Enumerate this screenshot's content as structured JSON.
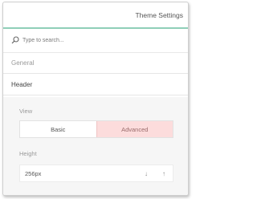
{
  "window": {
    "title": "Theme Settings"
  },
  "search": {
    "placeholder": "Type to search..."
  },
  "sections": {
    "general_label": "General",
    "header_label": "Header"
  },
  "view": {
    "label": "View",
    "options": [
      "Basic",
      "Advanced"
    ],
    "selected": "Advanced"
  },
  "height": {
    "label": "Height",
    "value": "256px",
    "down_icon": "↓",
    "up_icon": "↑"
  },
  "colors": {
    "accent_line": "#8fcfb8",
    "selected_option_bg": "#fcdcdc"
  }
}
